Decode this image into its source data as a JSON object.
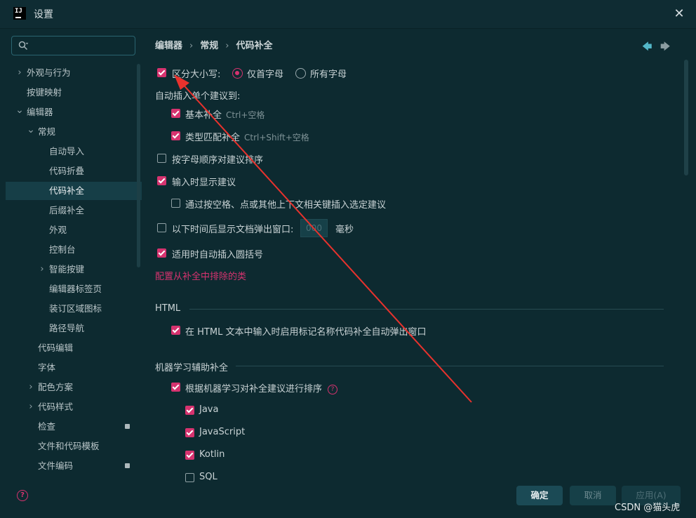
{
  "window": {
    "title": "设置",
    "close_glyph": "✕",
    "logo_text": "IJ"
  },
  "sidebar": {
    "search": {
      "value": "",
      "placeholder": ""
    },
    "items": [
      {
        "label": "外观与行为",
        "expanded": false,
        "has_chevron": true
      },
      {
        "label": "按键映射",
        "has_chevron": false
      },
      {
        "label": "编辑器",
        "expanded": true,
        "has_chevron": true
      },
      {
        "label": "常规",
        "expanded": true,
        "has_chevron": true
      },
      {
        "label": "自动导入"
      },
      {
        "label": "代码折叠"
      },
      {
        "label": "代码补全",
        "selected": true
      },
      {
        "label": "后缀补全"
      },
      {
        "label": "外观"
      },
      {
        "label": "控制台"
      },
      {
        "label": "智能按键",
        "expanded": false,
        "has_chevron": true
      },
      {
        "label": "编辑器标签页"
      },
      {
        "label": "装订区域图标"
      },
      {
        "label": "路径导航"
      },
      {
        "label": "代码编辑"
      },
      {
        "label": "字体"
      },
      {
        "label": "配色方案",
        "expanded": false,
        "has_chevron": true
      },
      {
        "label": "代码样式",
        "expanded": false,
        "has_chevron": true
      },
      {
        "label": "检查",
        "locked": true
      },
      {
        "label": "文件和代码模板"
      },
      {
        "label": "文件编码",
        "locked": true
      }
    ]
  },
  "breadcrumb": {
    "part1": "编辑器",
    "part2": "常规",
    "part3": "代码补全",
    "sep": "›"
  },
  "nav": {
    "back": "🡄",
    "forward": "🡆"
  },
  "settings": {
    "case_sensitive": {
      "label": "区分大小写:",
      "checked": true
    },
    "radio_first_letter": {
      "label": "仅首字母",
      "selected": true
    },
    "radio_all_letters": {
      "label": "所有字母",
      "selected": false
    },
    "auto_insert_heading": "自动插入单个建议到:",
    "basic_completion": {
      "label": "基本补全",
      "hint": "Ctrl+空格",
      "checked": true
    },
    "type_match_completion": {
      "label": "类型匹配补全",
      "hint": "Ctrl+Shift+空格",
      "checked": true
    },
    "sort_alpha": {
      "label": "按字母顺序对建议排序",
      "checked": false
    },
    "show_while_typing": {
      "label": "输入时显示建议",
      "checked": true
    },
    "insert_selected_by_space": {
      "label": "通过按空格、点或其他上下文相关键插入选定建议",
      "checked": false
    },
    "doc_popup": {
      "label": "以下时间后显示文档弹出窗口:",
      "checked": false,
      "value": "000",
      "unit": "毫秒"
    },
    "auto_parens": {
      "label": "适用时自动插入圆括号",
      "checked": true
    },
    "exclude_link": "配置从补全中排除的类",
    "html_section": "HTML",
    "html_auto_popup": {
      "label": "在 HTML 文本中输入时启用标记名称代码补全自动弹出窗口",
      "checked": true
    },
    "ml_section": "机器学习辅助补全",
    "ml_sort": {
      "label": "根据机器学习对补全建议进行排序",
      "checked": true,
      "help": "?"
    },
    "ml_languages": [
      {
        "label": "Java",
        "checked": true
      },
      {
        "label": "JavaScript",
        "checked": true
      },
      {
        "label": "Kotlin",
        "checked": true
      },
      {
        "label": "SQL",
        "checked": false
      }
    ]
  },
  "footer": {
    "help": "?",
    "ok": "确定",
    "cancel": "取消",
    "apply": "应用(A)"
  },
  "watermark": "CSDN @猫头虎",
  "colors": {
    "accent": "#d6336f",
    "background": "#0d2a30",
    "annotation_arrow": "#e8322d"
  }
}
